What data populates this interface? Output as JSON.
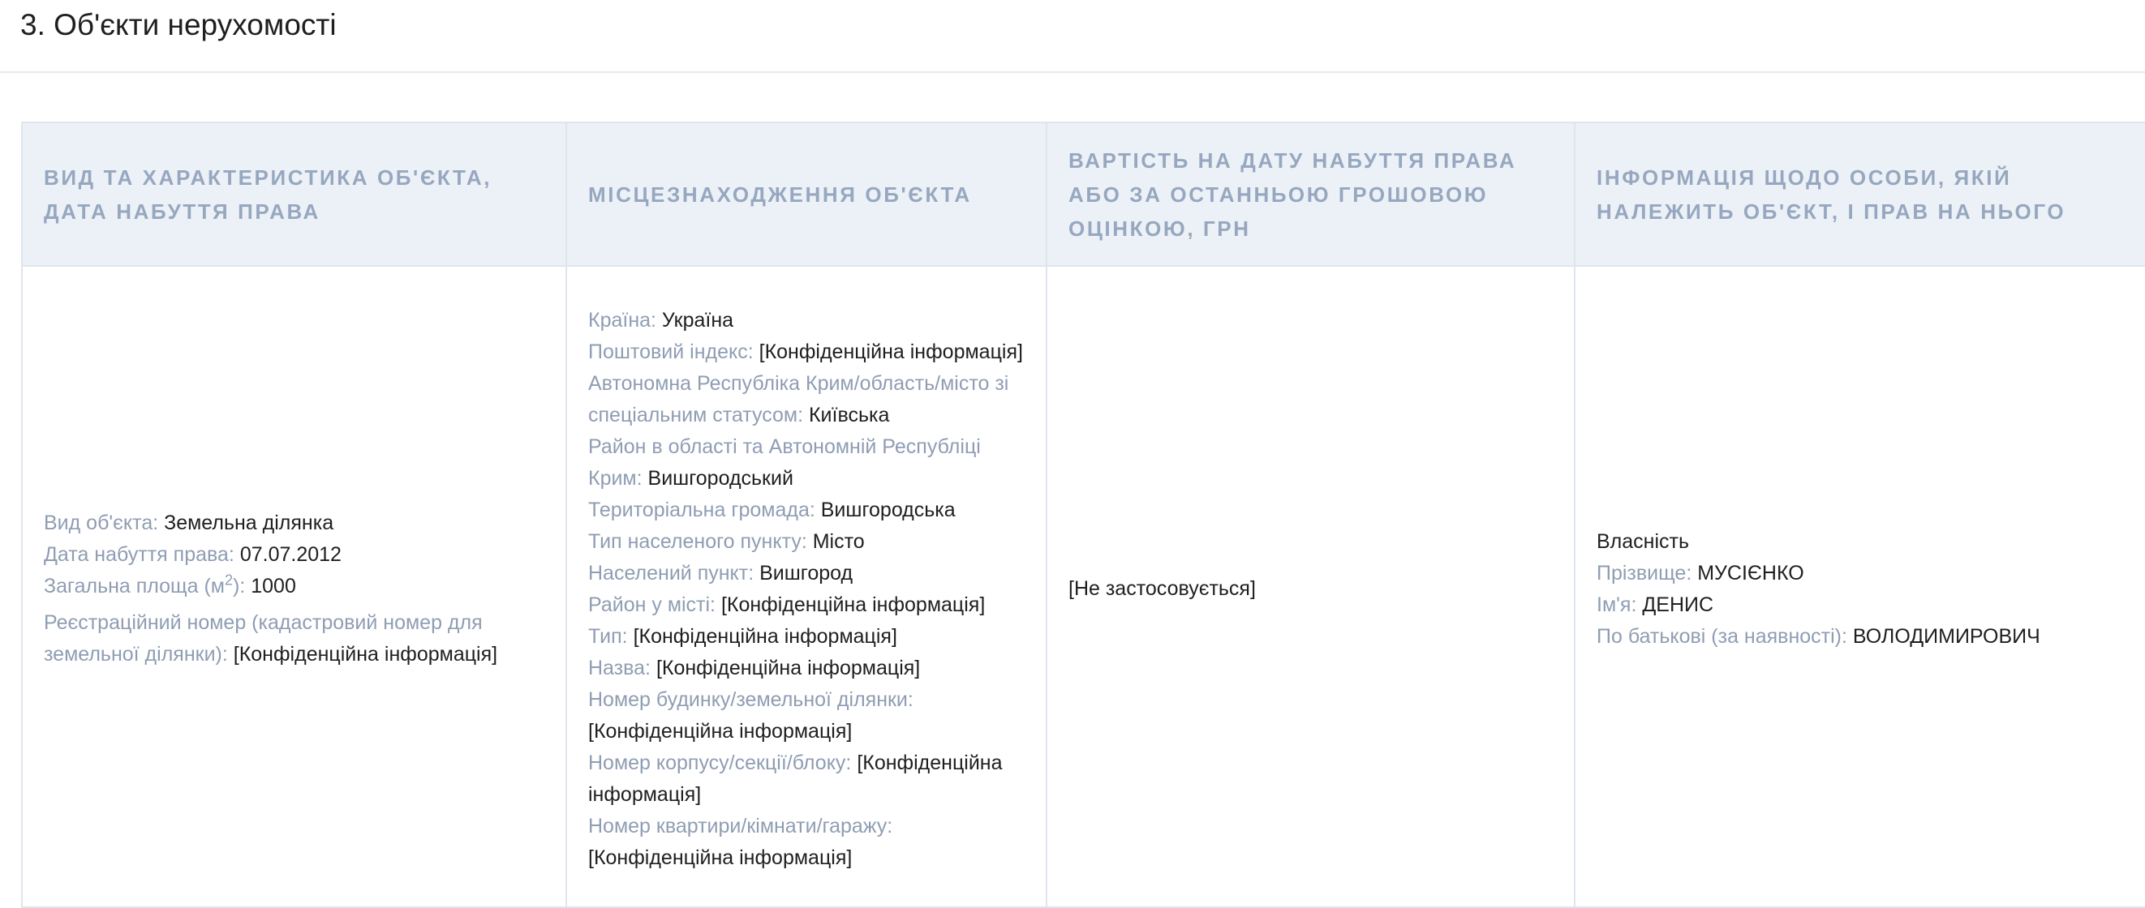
{
  "section": {
    "title": "3. Об'єкти нерухомості"
  },
  "table": {
    "headers": [
      "ВИД ТА ХАРАКТЕРИСТИКА ОБ'ЄКТА, ДАТА НАБУТТЯ ПРАВА",
      "МІСЦЕЗНАХОДЖЕННЯ ОБ'ЄКТА",
      "ВАРТІСТЬ НА ДАТУ НАБУТТЯ ПРАВА АБО ЗА ОСТАННЬОЮ ГРОШОВОЮ ОЦІНКОЮ, ГРН",
      "ІНФОРМАЦІЯ ЩОДО ОСОБИ, ЯКІЙ НАЛЕЖИТЬ ОБ'ЄКТ, І ПРАВ НА НЬОГО"
    ],
    "row": {
      "object": {
        "type_label": "Вид об'єкта: ",
        "type_value": "Земельна ділянка",
        "date_label": "Дата набуття права: ",
        "date_value": "07.07.2012",
        "area_label": "Загальна площа (м",
        "area_sup": "2",
        "area_label_end": "): ",
        "area_value": "1000",
        "reg_label": "Реєстраційний номер (кадастровий номер для земельної ділянки): ",
        "reg_value": "[Конфіденційна інформація]"
      },
      "location": [
        {
          "label": "Країна: ",
          "value": "Україна"
        },
        {
          "label": "Поштовий індекс: ",
          "value": "[Конфіденційна інформація]"
        },
        {
          "label": "Автономна Республіка Крим/область/місто зі спеціальним статусом: ",
          "value": "Київська"
        },
        {
          "label": "Район в області та Автономній Республіці Крим: ",
          "value": "Вишгородський"
        },
        {
          "label": "Територіальна громада: ",
          "value": "Вишгородська"
        },
        {
          "label": "Тип населеного пункту: ",
          "value": "Місто"
        },
        {
          "label": "Населений пункт: ",
          "value": "Вишгород"
        },
        {
          "label": "Район у місті: ",
          "value": "[Конфіденційна інформація]"
        },
        {
          "label": "Тип: ",
          "value": "[Конфіденційна інформація]"
        },
        {
          "label": "Назва: ",
          "value": "[Конфіденційна інформація]"
        },
        {
          "label": "Номер будинку/земельної ділянки: ",
          "value": "[Конфіденційна інформація]"
        },
        {
          "label": "Номер корпусу/секції/блоку: ",
          "value": "[Конфіденційна інформація]"
        },
        {
          "label": "Номер квартири/кімнати/гаражу: ",
          "value": "[Конфіденційна інформація]"
        }
      ],
      "value": "[Не застосовується]",
      "owner": {
        "right": "Власність",
        "surname_label": "Прізвище: ",
        "surname_value": "МУСІЄНКО",
        "name_label": "Ім'я: ",
        "name_value": "ДЕНИС",
        "patronymic_label": "По батькові (за наявності): ",
        "patronymic_value": "ВОЛОДИМИРОВИЧ"
      }
    }
  }
}
